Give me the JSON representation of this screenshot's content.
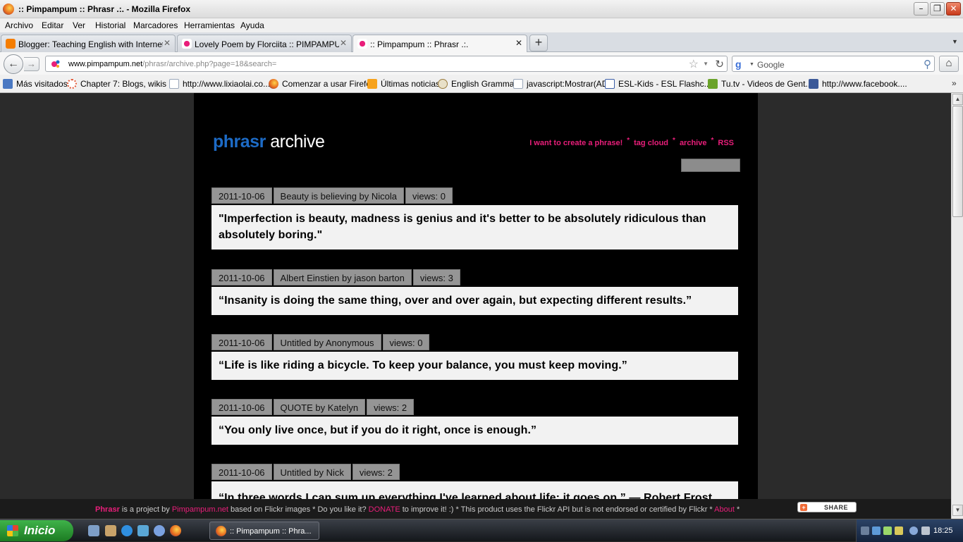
{
  "window": {
    "title": ":: Pimpampum :: Phrasr .:. - Mozilla Firefox"
  },
  "menu": [
    "Archivo",
    "Editar",
    "Ver",
    "Historial",
    "Marcadores",
    "Herramientas",
    "Ayuda"
  ],
  "tabs": [
    {
      "label": "Blogger: Teaching English with Internet - C...",
      "icon": "blogger-icon",
      "color": "#f57d00"
    },
    {
      "label": "Lovely Poem by Florciita :: PIMPAMPUM ::...",
      "icon": "pimpampum-icon",
      "color": "#e91e7a"
    },
    {
      "label": ":: Pimpampum :: Phrasr .:.",
      "icon": "pimpampum-icon",
      "color": "#e91e7a"
    }
  ],
  "newtab_label": "+",
  "url": {
    "domain": "www.pimpampum.net",
    "path": "/phrasr/archive.php?page=18&search="
  },
  "search": {
    "engine": "Google",
    "placeholder": "Google"
  },
  "bookmarks": [
    {
      "label": "Más visitados",
      "icon": "most-visited-icon",
      "color": "#4a78c2"
    },
    {
      "label": "Chapter 7: Blogs, wikis ...",
      "icon": "chapter-icon",
      "color": "#e35a3a"
    },
    {
      "label": "http://www.lixiaolai.co...",
      "icon": "page-icon",
      "color": "#dfe6ef"
    },
    {
      "label": "Comenzar a usar Firefox",
      "icon": "firefox-icon",
      "color": "#e3621d"
    },
    {
      "label": "Últimas noticias",
      "icon": "rss-icon",
      "color": "#f7a21b"
    },
    {
      "label": "English Grammar",
      "icon": "gear-icon",
      "color": "#9a7b3d"
    },
    {
      "label": "javascript:Mostrar(AD);",
      "icon": "page-icon",
      "color": "#dfe6ef"
    },
    {
      "label": "ESL-Kids - ESL Flashc...",
      "icon": "esl-kids-icon",
      "color": "#3b5ea8"
    },
    {
      "label": "Tu.tv - Videos de Gent...",
      "icon": "tutv-icon",
      "color": "#6aa329"
    },
    {
      "label": "http://www.facebook....",
      "icon": "facebook-icon",
      "color": "#3b5998"
    }
  ],
  "site": {
    "logo_brand": "phrasr",
    "logo_section": "archive",
    "nav": [
      "I want to create a phrase!",
      "tag cloud",
      "archive",
      "RSS"
    ],
    "nav_separator": "*",
    "entries": [
      {
        "date": "2011-10-06",
        "title": "Beauty is believing by Nicola",
        "views": "views: 0",
        "quote": "\"Imperfection is beauty, madness is genius and it's better to be absolutely ridiculous than absolutely boring.\""
      },
      {
        "date": "2011-10-06",
        "title": "Albert Einstien by jason barton",
        "views": "views: 3",
        "quote": "“Insanity is doing the same thing, over and over again, but expecting different results.”"
      },
      {
        "date": "2011-10-06",
        "title": "Untitled by Anonymous",
        "views": "views: 0",
        "quote": "“Life is like riding a bicycle. To keep your balance, you must keep moving.”"
      },
      {
        "date": "2011-10-06",
        "title": "QUOTE by Katelyn",
        "views": "views: 2",
        "quote": "“You only live once, but if you do it right, once is enough.”"
      },
      {
        "date": "2011-10-06",
        "title": "Untitled by Nick",
        "views": "views: 2",
        "quote": "“In three words I can sum up everything I've learned about life: it goes on.” — Robert Frost"
      }
    ]
  },
  "footer": {
    "brand": "Phrasr",
    "t1": " is a project by ",
    "link1": "Pimpampum.net",
    "t2": " based on Flickr images * Do you like it? ",
    "link2": "DONATE",
    "t3": " to improve it! :) * This product uses the Flickr API but is not endorsed or certified by Flickr * ",
    "link3": "About",
    "t4": " *",
    "share": "SHARE"
  },
  "taskbar": {
    "start": "Inicio",
    "task": ":: Pimpampum :: Phra...",
    "clock": "18:25"
  },
  "colors": {
    "accent_pink": "#e91e7a",
    "phrasr_blue": "#1d6bc6"
  }
}
